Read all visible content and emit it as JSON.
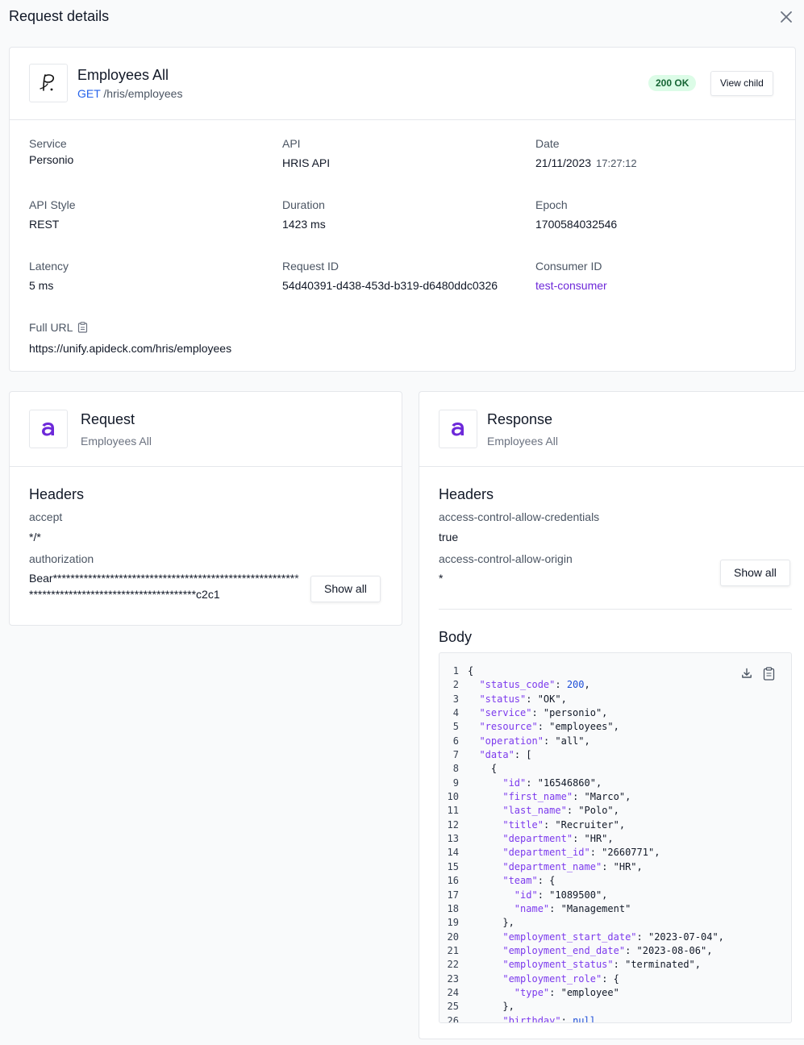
{
  "page": {
    "title": "Request details"
  },
  "summary": {
    "name": "Employees All",
    "method": "GET",
    "path": "/hris/employees",
    "status": "200 OK",
    "view_child": "View child",
    "fields": {
      "service": {
        "label": "Service",
        "value": "Personio"
      },
      "api": {
        "label": "API",
        "value": "HRIS API"
      },
      "date": {
        "label": "Date",
        "value": "21/11/2023",
        "time": "17:27:12"
      },
      "api_style": {
        "label": "API Style",
        "value": "REST"
      },
      "duration": {
        "label": "Duration",
        "value": "1423 ms"
      },
      "epoch": {
        "label": "Epoch",
        "value": "1700584032546"
      },
      "latency": {
        "label": "Latency",
        "value": "5 ms"
      },
      "request_id": {
        "label": "Request ID",
        "value": "54d40391-d438-453d-b319-d6480ddc0326"
      },
      "consumer_id": {
        "label": "Consumer ID",
        "value": "test-consumer"
      },
      "full_url": {
        "label": "Full URL",
        "value": "https://unify.apideck.com/hris/employees"
      }
    }
  },
  "request": {
    "title": "Request",
    "subtitle": "Employees All",
    "headers_title": "Headers",
    "headers": [
      {
        "name": "accept",
        "value": "*/*"
      },
      {
        "name": "authorization",
        "value": "Bear********************************************************",
        "value2": "**************************************c2c1"
      }
    ],
    "show_all": "Show all"
  },
  "response": {
    "title": "Response",
    "subtitle": "Employees All",
    "headers_title": "Headers",
    "headers": [
      {
        "name": "access-control-allow-credentials",
        "value": "true"
      },
      {
        "name": "access-control-allow-origin",
        "value": "*"
      }
    ],
    "show_all": "Show all",
    "body_title": "Body",
    "body_lines": [
      "{",
      "  \"status_code\": 200,",
      "  \"status\": \"OK\",",
      "  \"service\": \"personio\",",
      "  \"resource\": \"employees\",",
      "  \"operation\": \"all\",",
      "  \"data\": [",
      "    {",
      "      \"id\": \"16546860\",",
      "      \"first_name\": \"Marco\",",
      "      \"last_name\": \"Polo\",",
      "      \"title\": \"Recruiter\",",
      "      \"department\": \"HR\",",
      "      \"department_id\": \"2660771\",",
      "      \"department_name\": \"HR\",",
      "      \"team\": {",
      "        \"id\": \"1089500\",",
      "        \"name\": \"Management\"",
      "      },",
      "      \"employment_start_date\": \"2023-07-04\",",
      "      \"employment_end_date\": \"2023-08-06\",",
      "      \"employment_status\": \"terminated\",",
      "      \"employment_role\": {",
      "        \"type\": \"employee\"",
      "      },",
      "      \"birthday\": null"
    ]
  },
  "icons": {
    "close": "close-icon",
    "copy": "clipboard-icon",
    "download": "download-icon",
    "personio_logo": "personio-logo",
    "apideck_logo": "apideck-logo"
  },
  "colors": {
    "accent_purple": "#6d28d9",
    "method_blue": "#2563eb",
    "success_bg": "#dcfce7",
    "success_text": "#166534",
    "json_key": "#7c3aed",
    "json_number": "#1d4ed8"
  }
}
